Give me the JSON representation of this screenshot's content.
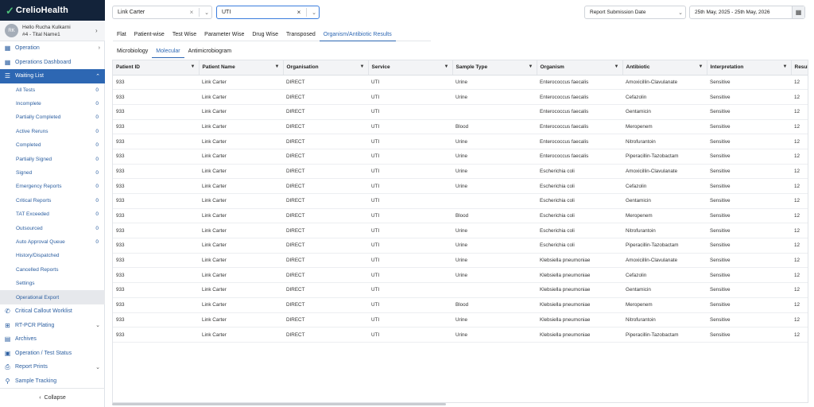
{
  "brand": {
    "name": "CrelioHealth"
  },
  "user": {
    "initials": "RK",
    "name": "Hello Rucha Kulkarni",
    "subtitle": "#4 - Tital Name1"
  },
  "nav": {
    "operation": "Operation",
    "operations_dashboard": "Operations Dashboard",
    "waiting_list": "Waiting List",
    "waiting_items": [
      {
        "label": "All Tests",
        "count": "0"
      },
      {
        "label": "Incomplete",
        "count": "0"
      },
      {
        "label": "Partially Completed",
        "count": "0"
      },
      {
        "label": "Active Reruns",
        "count": "0"
      },
      {
        "label": "Completed",
        "count": "0"
      },
      {
        "label": "Partially Signed",
        "count": "0"
      },
      {
        "label": "Signed",
        "count": "0"
      },
      {
        "label": "Emergency Reports",
        "count": "0"
      },
      {
        "label": "Critical Reports",
        "count": "0"
      },
      {
        "label": "TAT Exceeded",
        "count": "0"
      },
      {
        "label": "Outsourced",
        "count": "0"
      },
      {
        "label": "Auto Approval Queue",
        "count": "0"
      },
      {
        "label": "History/Dispatched",
        "count": ""
      },
      {
        "label": "Cancelled Reports",
        "count": ""
      },
      {
        "label": "Settings",
        "count": ""
      },
      {
        "label": "Operational Export",
        "count": ""
      }
    ],
    "critical_callout": "Critical Callout Worklist",
    "rt_pcr": "RT-PCR Plating",
    "archives": "Archives",
    "operation_test_status": "Operation / Test Status",
    "report_prints": "Report Prints",
    "sample_tracking": "Sample Tracking",
    "collapse": "Collapse"
  },
  "filters": {
    "patient": "Link Carter",
    "service": "UTI",
    "date_type": "Report Submission Date",
    "date_range": "25th May, 2025 - 25th May, 2026"
  },
  "tabs": [
    "Flat",
    "Patient-wise",
    "Test Wise",
    "Parameter Wise",
    "Drug Wise",
    "Transposed",
    "Organism/Antibiotic Results"
  ],
  "subtabs": [
    "Microbiology",
    "Molecular",
    "Antimicrobiogram"
  ],
  "table": {
    "columns": [
      "Patient ID",
      "Patient Name",
      "Organisation",
      "Service",
      "Sample Type",
      "Organism",
      "Antibiotic",
      "Interpretation",
      "Resul"
    ],
    "rows": [
      [
        "933",
        "Link Carter",
        "DIRECT",
        "UTI",
        "Urine",
        "Enterococcus faecalis",
        "Amoxicillin-Clavulanate",
        "Sensitive",
        "12"
      ],
      [
        "933",
        "Link Carter",
        "DIRECT",
        "UTI",
        "Urine",
        "Enterococcus faecalis",
        "Cefazolin",
        "Sensitive",
        "12"
      ],
      [
        "933",
        "Link Carter",
        "DIRECT",
        "UTI",
        "",
        "Enterococcus faecalis",
        "Gentamicin",
        "Sensitive",
        "12"
      ],
      [
        "933",
        "Link Carter",
        "DIRECT",
        "UTI",
        "Blood",
        "Enterococcus faecalis",
        "Meropenem",
        "Sensitive",
        "12"
      ],
      [
        "933",
        "Link Carter",
        "DIRECT",
        "UTI",
        "Urine",
        "Enterococcus faecalis",
        "Nitrofurantoin",
        "Sensitive",
        "12"
      ],
      [
        "933",
        "Link Carter",
        "DIRECT",
        "UTI",
        "Urine",
        "Enterococcus faecalis",
        "Piperacillin-Tazobactam",
        "Sensitive",
        "12"
      ],
      [
        "933",
        "Link Carter",
        "DIRECT",
        "UTI",
        "Urine",
        "Escherichia coli",
        "Amoxicillin-Clavulanate",
        "Sensitive",
        "12"
      ],
      [
        "933",
        "Link Carter",
        "DIRECT",
        "UTI",
        "Urine",
        "Escherichia coli",
        "Cefazolin",
        "Sensitive",
        "12"
      ],
      [
        "933",
        "Link Carter",
        "DIRECT",
        "UTI",
        "",
        "Escherichia coli",
        "Gentamicin",
        "Sensitive",
        "12"
      ],
      [
        "933",
        "Link Carter",
        "DIRECT",
        "UTI",
        "Blood",
        "Escherichia coli",
        "Meropenem",
        "Sensitive",
        "12"
      ],
      [
        "933",
        "Link Carter",
        "DIRECT",
        "UTI",
        "Urine",
        "Escherichia coli",
        "Nitrofurantoin",
        "Sensitive",
        "12"
      ],
      [
        "933",
        "Link Carter",
        "DIRECT",
        "UTI",
        "Urine",
        "Escherichia coli",
        "Piperacillin-Tazobactam",
        "Sensitive",
        "12"
      ],
      [
        "933",
        "Link Carter",
        "DIRECT",
        "UTI",
        "Urine",
        "Klebsiella pneumoniae",
        "Amoxicillin-Clavulanate",
        "Sensitive",
        "12"
      ],
      [
        "933",
        "Link Carter",
        "DIRECT",
        "UTI",
        "Urine",
        "Klebsiella pneumoniae",
        "Cefazolin",
        "Sensitive",
        "12"
      ],
      [
        "933",
        "Link Carter",
        "DIRECT",
        "UTI",
        "",
        "Klebsiella pneumoniae",
        "Gentamicin",
        "Sensitive",
        "12"
      ],
      [
        "933",
        "Link Carter",
        "DIRECT",
        "UTI",
        "Blood",
        "Klebsiella pneumoniae",
        "Meropenem",
        "Sensitive",
        "12"
      ],
      [
        "933",
        "Link Carter",
        "DIRECT",
        "UTI",
        "Urine",
        "Klebsiella pneumoniae",
        "Nitrofurantoin",
        "Sensitive",
        "12"
      ],
      [
        "933",
        "Link Carter",
        "DIRECT",
        "UTI",
        "Urine",
        "Klebsiella pneumoniae",
        "Piperacillin-Tazobactam",
        "Sensitive",
        "12"
      ]
    ]
  },
  "colors": {
    "sidebar_header": "#13233a",
    "accent": "#2d67b3",
    "brand_check": "#4ec27a"
  }
}
